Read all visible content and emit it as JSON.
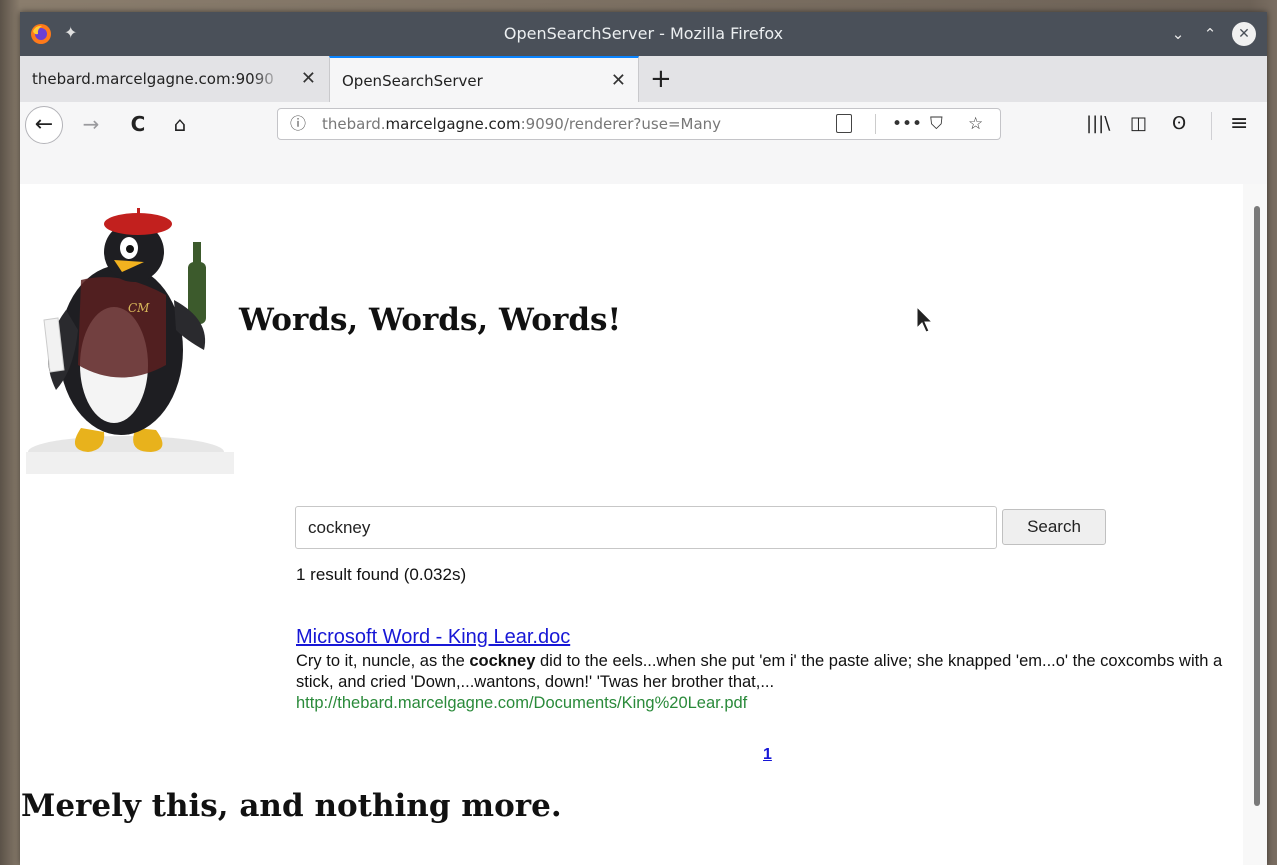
{
  "window": {
    "title": "OpenSearchServer - Mozilla Firefox",
    "controls": {
      "minimize": "⌄",
      "maximize": "⌃",
      "close": "✕"
    }
  },
  "tabs": [
    {
      "label": "thebard.marcelgagne.com:9090",
      "close": "✕",
      "active": false
    },
    {
      "label": "OpenSearchServer",
      "close": "✕",
      "active": true
    }
  ],
  "newtab_label": "+",
  "nav": {
    "back": "←",
    "forward": "→",
    "reload": "C",
    "home": "⌂",
    "url_prefix": "thebard.",
    "url_domain": "marcelgagne.com",
    "url_suffix": ":9090/renderer?use=Many",
    "info": "ⓘ",
    "page_actions": "•••",
    "pocket": "⛉",
    "bookmark": "☆",
    "library": "|||\\",
    "sidebar": "◫",
    "account": "ʘ",
    "menu": "≡"
  },
  "page": {
    "headline": "Words, Words, Words!",
    "search_value": "cockney",
    "search_button": "Search",
    "result_count": "1 result found (0.032s)",
    "result": {
      "title": "Microsoft Word - King Lear.doc",
      "snippet_before": "Cry to it, nuncle, as the ",
      "snippet_bold": "cockney",
      "snippet_after": " did to the eels...when she put 'em i' the paste alive; she knapped 'em...o' the coxcombs with a stick, and cried 'Down,...wantons, down!' 'Twas her brother that,...",
      "url": "http://thebard.marcelgagne.com/Documents/King%20Lear.pdf"
    },
    "pager": "1",
    "footer": "Merely this, and nothing more."
  },
  "colors": {
    "titlebar": "#4a5059",
    "active_tab_accent": "#0a84ff",
    "link": "#1717d6",
    "result_url": "#2a8a3a"
  }
}
